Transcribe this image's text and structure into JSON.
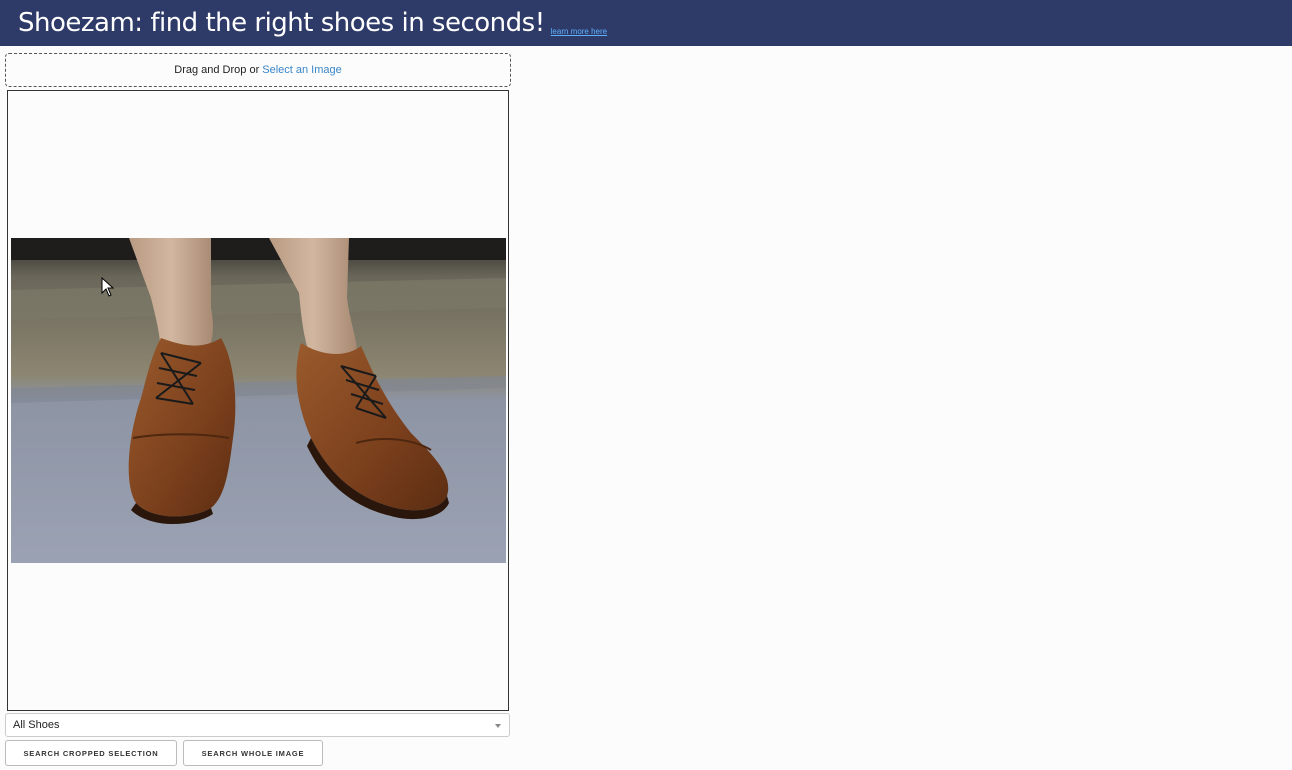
{
  "header": {
    "title": "Shoezam: find the right shoes in seconds!",
    "learn_more": "learn more here"
  },
  "upload": {
    "prompt": "Drag and Drop or",
    "select_link": "Select an Image"
  },
  "image": {
    "subject": "brown leather brogue oxford shoes on concrete"
  },
  "filter": {
    "selected": "All Shoes"
  },
  "actions": {
    "search_cropped": "SEARCH CROPPED SELECTION",
    "search_whole": "SEARCH WHOLE IMAGE"
  },
  "colors": {
    "header_bg": "#2e3a67",
    "link": "#3a86c8",
    "shoe_brown": "#8a4a22"
  }
}
